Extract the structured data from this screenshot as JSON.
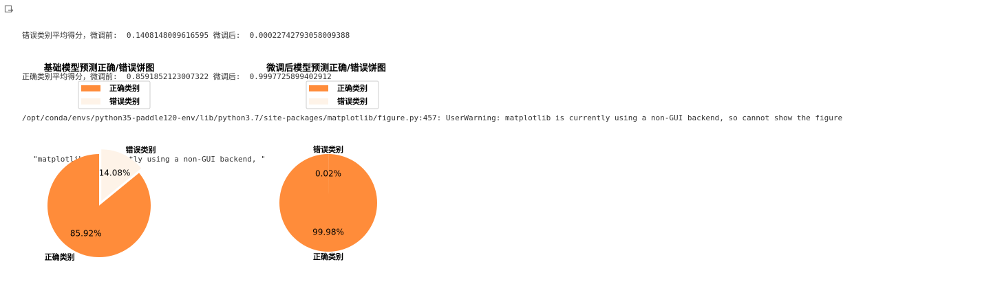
{
  "console": {
    "lines": [
      "错误类别平均得分，微调前:  0.1408148009616595 微调后:  0.00022742793058009388",
      "正确类别平均得分，微调前:  0.8591852123007322 微调后:  0.9997725899402912",
      "/opt/conda/envs/python35-paddle120-env/lib/python3.7/site-packages/matplotlib/figure.py:457: UserWarning: matplotlib is currently using a non-GUI backend, so cannot show the figure",
      "\"matplotlib is currently using a non-GUI backend, \""
    ]
  },
  "colors": {
    "correct": "#FF8C3A",
    "wrong": "#FEF3E8"
  },
  "chart_data": [
    {
      "type": "pie",
      "title": "基础模型预测正确/错误饼图",
      "categories": [
        "正确类别",
        "错误类别"
      ],
      "values": [
        85.92,
        14.08
      ],
      "value_labels": [
        "85.92%",
        "14.08%"
      ],
      "explode": [
        0,
        0.1
      ],
      "start_angle_deg": 90,
      "legend": {
        "placement": "upper-center",
        "entries": [
          "正确类别",
          "错误类别"
        ]
      }
    },
    {
      "type": "pie",
      "title": "微调后模型预测正确/错误饼图",
      "categories": [
        "正确类别",
        "错误类别"
      ],
      "values": [
        99.98,
        0.02
      ],
      "value_labels": [
        "99.98%",
        "0.02%"
      ],
      "explode": [
        0,
        0
      ],
      "start_angle_deg": 90,
      "legend": {
        "placement": "upper-center",
        "entries": [
          "正确类别",
          "错误类别"
        ]
      }
    }
  ]
}
